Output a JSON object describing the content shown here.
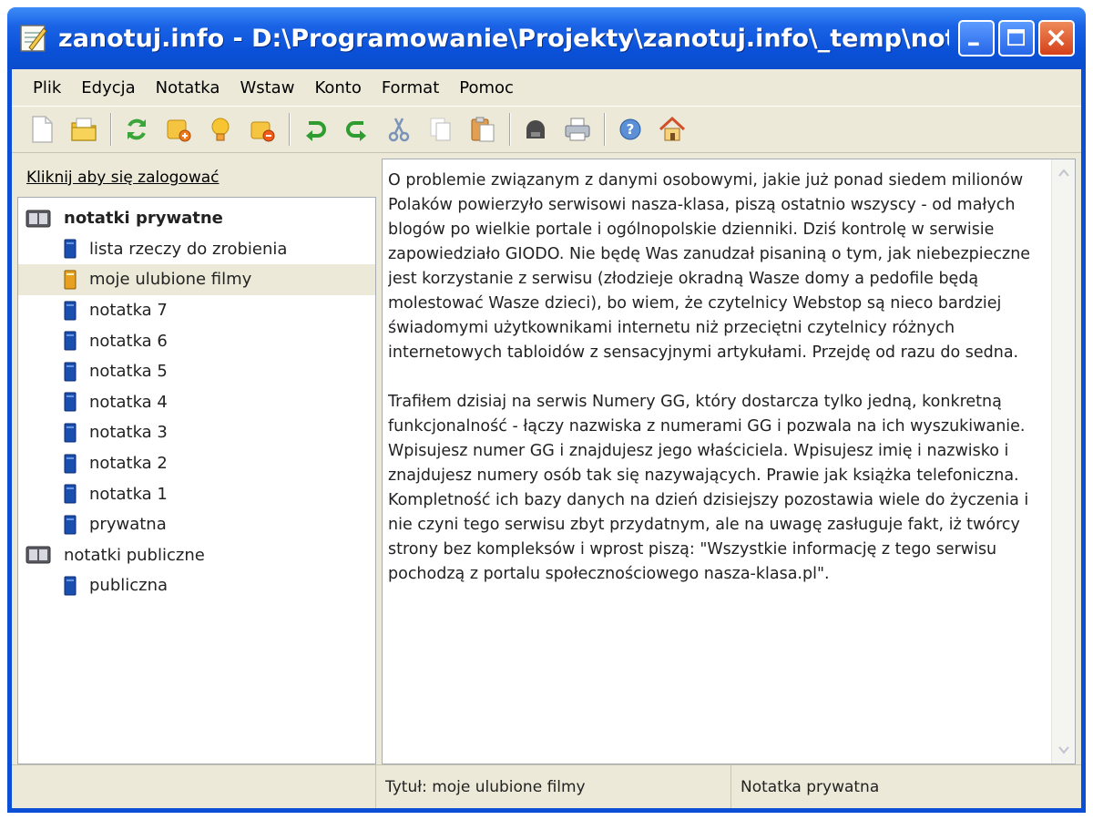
{
  "window": {
    "title": "zanotuj.info - D:\\Programowanie\\Projekty\\zanotuj.info\\_temp\\notatnik.dry"
  },
  "menu": [
    "Plik",
    "Edycja",
    "Notatka",
    "Wstaw",
    "Konto",
    "Format",
    "Pomoc"
  ],
  "toolbar": {
    "groups": [
      [
        "new-note-icon",
        "open-folder-icon"
      ],
      [
        "refresh-icon",
        "add-note-icon",
        "lightbulb-icon",
        "delete-note-icon"
      ],
      [
        "undo-icon",
        "redo-icon",
        "cut-icon",
        "copy-icon",
        "paste-icon"
      ],
      [
        "save-icon",
        "print-icon"
      ],
      [
        "help-icon",
        "home-icon"
      ]
    ]
  },
  "sidebar": {
    "login_link": "Kliknij aby się zalogować",
    "groups": [
      {
        "label": "notatki prywatne",
        "bold": true,
        "items": [
          {
            "label": "lista rzeczy do zrobienia",
            "selected": false
          },
          {
            "label": "moje ulubione filmy",
            "selected": true
          },
          {
            "label": "notatka 7",
            "selected": false
          },
          {
            "label": "notatka 6",
            "selected": false
          },
          {
            "label": "notatka 5",
            "selected": false
          },
          {
            "label": "notatka 4",
            "selected": false
          },
          {
            "label": "notatka 3",
            "selected": false
          },
          {
            "label": "notatka 2",
            "selected": false
          },
          {
            "label": "notatka 1",
            "selected": false
          },
          {
            "label": "prywatna",
            "selected": false
          }
        ]
      },
      {
        "label": "notatki publiczne",
        "bold": false,
        "items": [
          {
            "label": "publiczna",
            "selected": false
          }
        ]
      }
    ]
  },
  "editor": {
    "content": "O problemie związanym z danymi osobowymi, jakie już ponad siedem milionów Polaków powierzyło serwisowi nasza-klasa, piszą ostatnio wszyscy - od małych blogów po wielkie portale i ogólnopolskie dzienniki. Dziś kontrolę w serwisie zapowiedziało GIODO. Nie będę Was zanudzał pisaniną o tym, jak niebezpieczne jest korzystanie z serwisu (złodzieje okradną Wasze domy a pedofile będą molestować Wasze dzieci), bo wiem, że czytelnicy Webstop są nieco bardziej świadomymi użytkownikami internetu niż przeciętni czytelnicy różnych internetowych tabloidów z sensacyjnymi artykułami. Przejdę od razu do sedna.\n\nTrafiłem dzisiaj na serwis Numery GG, który dostarcza tylko jedną, konkretną funkcjonalność - łączy nazwiska z numerami GG i pozwala na ich wyszukiwanie. Wpisujesz numer GG i znajdujesz jego właściciela. Wpisujesz imię i nazwisko i znajdujesz numery osób tak się nazywających. Prawie jak książka telefoniczna. Kompletność ich bazy danych na dzień dzisiejszy pozostawia wiele do życzenia i nie czyni tego serwisu zbyt przydatnym, ale na uwagę zasługuje fakt, iż twórcy strony bez kompleksów i wprost piszą: \"Wszystkie informację z tego serwisu pochodzą z portalu społecznościowego nasza-klasa.pl\"."
  },
  "status": {
    "cell1": "",
    "cell2": "Tytuł: moje ulubione filmy",
    "cell3": "Notatka prywatna"
  }
}
